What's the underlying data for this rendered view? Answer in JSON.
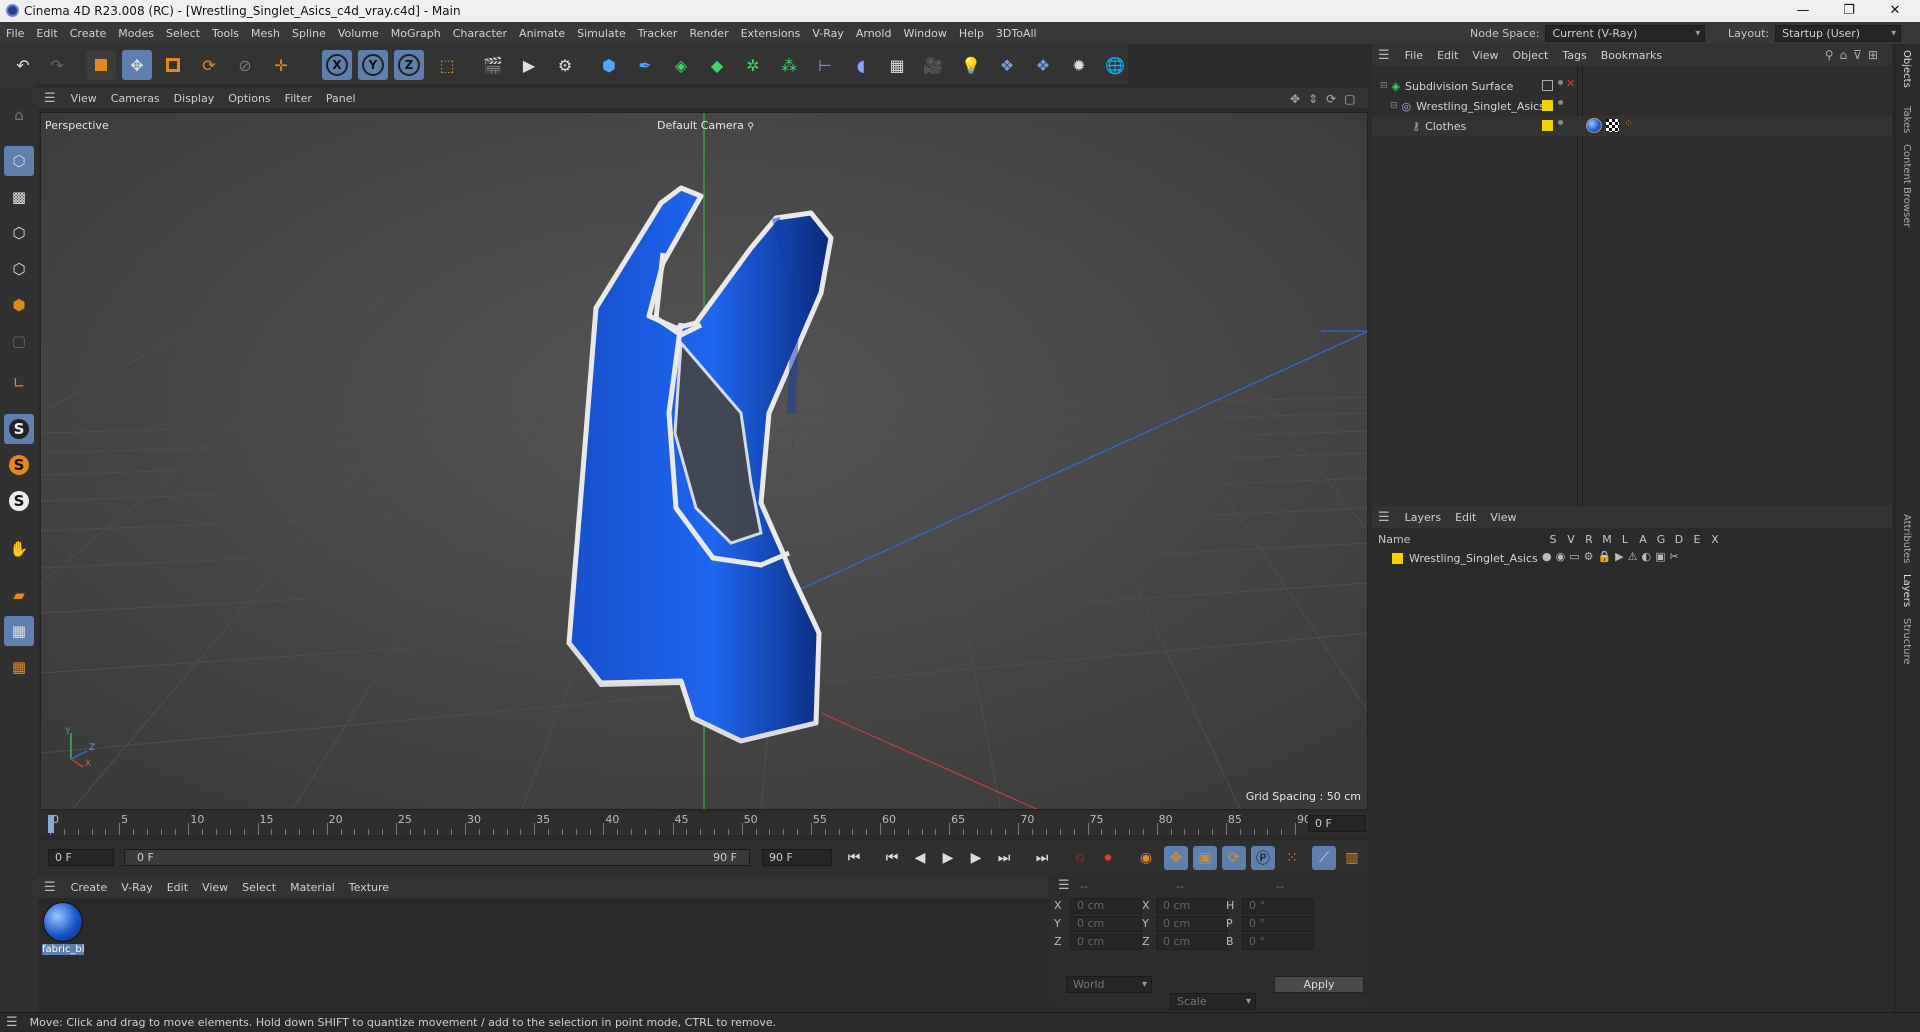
{
  "window": {
    "title": "Cinema 4D R23.008 (RC) - [Wrestling_Singlet_Asics_c4d_vray.c4d] - Main"
  },
  "menu": [
    "File",
    "Edit",
    "Create",
    "Modes",
    "Select",
    "Tools",
    "Mesh",
    "Spline",
    "Volume",
    "MoGraph",
    "Character",
    "Animate",
    "Simulate",
    "Tracker",
    "Render",
    "Extensions",
    "V-Ray",
    "Arnold",
    "Window",
    "Help",
    "3DToAll"
  ],
  "header": {
    "node_space_label": "Node Space:",
    "node_space_value": "Current (V-Ray)",
    "layout_label": "Layout:",
    "layout_value": "Startup (User)"
  },
  "viewport": {
    "menu": [
      "View",
      "Cameras",
      "Display",
      "Options",
      "Filter",
      "Panel"
    ],
    "view_name": "Perspective",
    "camera": "Default Camera",
    "grid_spacing": "Grid Spacing : 50 cm",
    "axis": {
      "y": "Y",
      "z": "Z",
      "x": "X"
    },
    "object_color": "#1a5ee6"
  },
  "timeline": {
    "ticks": [
      "0",
      "5",
      "10",
      "15",
      "20",
      "25",
      "30",
      "35",
      "40",
      "45",
      "50",
      "55",
      "60",
      "65",
      "70",
      "75",
      "80",
      "85",
      "90"
    ],
    "current": "0 F"
  },
  "transport": {
    "start": "0 F",
    "range_start": "0 F",
    "range_end": "90 F",
    "end": "90 F"
  },
  "materials": {
    "menu": [
      "Create",
      "V-Ray",
      "Edit",
      "View",
      "Select",
      "Material",
      "Texture"
    ],
    "items": [
      {
        "name": "fabric_bl"
      }
    ]
  },
  "coords": {
    "headers": [
      "--",
      "--",
      "--"
    ],
    "rows": [
      {
        "a": "X",
        "av": "0 cm",
        "b": "X",
        "bv": "0 cm",
        "c": "H",
        "cv": "0 °"
      },
      {
        "a": "Y",
        "av": "0 cm",
        "b": "Y",
        "bv": "0 cm",
        "c": "P",
        "cv": "0 °"
      },
      {
        "a": "Z",
        "av": "0 cm",
        "b": "Z",
        "bv": "0 cm",
        "c": "B",
        "cv": "0 °"
      }
    ],
    "space": "World",
    "mode": "Scale",
    "apply": "Apply"
  },
  "objects": {
    "menu": [
      "File",
      "Edit",
      "View",
      "Object",
      "Tags",
      "Bookmarks"
    ],
    "items": [
      {
        "name": "Subdivision Surface"
      },
      {
        "name": "Wrestling_Singlet_Asics"
      },
      {
        "name": "Clothes"
      }
    ]
  },
  "layers": {
    "menu": [
      "Layers",
      "Edit",
      "View"
    ],
    "columns": {
      "name": "Name",
      "flags": [
        "S",
        "V",
        "R",
        "M",
        "L",
        "A",
        "G",
        "D",
        "E",
        "X"
      ]
    },
    "items": [
      {
        "name": "Wrestling_Singlet_Asics",
        "color": "#f2d200"
      }
    ]
  },
  "side_tabs": [
    "Objects",
    "Takes",
    "Content Browser",
    "Attributes",
    "Layers",
    "Structure"
  ],
  "status": {
    "text": "Move: Click and drag to move elements. Hold down SHIFT to quantize movement / add to the selection in point mode, CTRL to remove."
  },
  "colors": {
    "accent": "#5f7fae",
    "layer_yellow": "#f2d200"
  }
}
